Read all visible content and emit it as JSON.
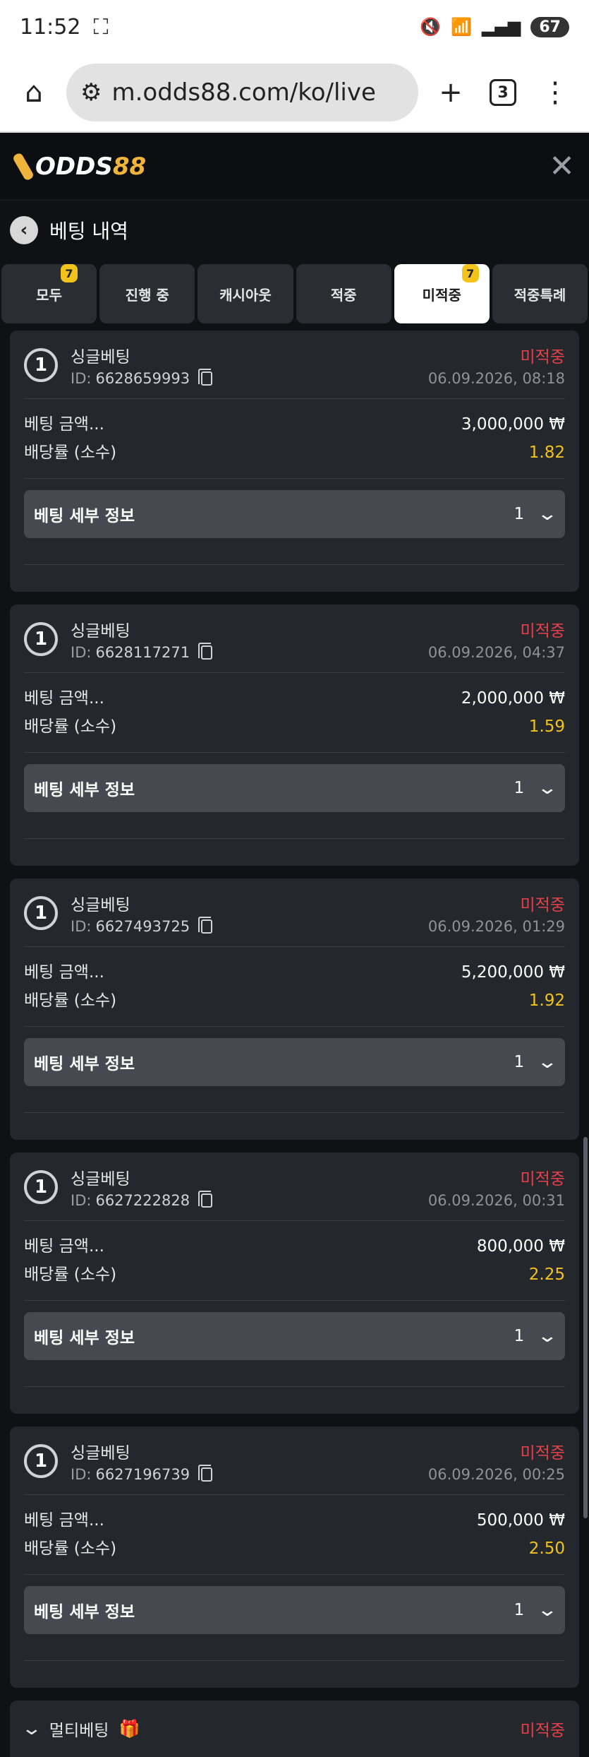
{
  "status_bar": {
    "time": "11:52",
    "battery": "67"
  },
  "browser": {
    "url": "m.odds88.com/ko/live",
    "tab_count": "3"
  },
  "app": {
    "logo_a": "ODDS",
    "logo_b": "88"
  },
  "page": {
    "title": "베팅 내역"
  },
  "tabs": [
    {
      "label": "모두",
      "badge": "7",
      "active": false
    },
    {
      "label": "진행 중",
      "badge": "",
      "active": false
    },
    {
      "label": "캐시아웃",
      "badge": "",
      "active": false
    },
    {
      "label": "적중",
      "badge": "",
      "active": false
    },
    {
      "label": "미적중",
      "badge": "7",
      "active": true
    },
    {
      "label": "적중특례",
      "badge": "",
      "active": false
    }
  ],
  "labels": {
    "amount": "베팅 금액...",
    "odds": "배당률 (소수)",
    "details": "베팅 세부 정보"
  },
  "bets": [
    {
      "num": "1",
      "type": "싱글베팅",
      "id": "6628659993",
      "status": "미적중",
      "date": "06.09.2026, 08:18",
      "amount": "3,000,000 ₩",
      "odds": "1.82",
      "count": "1"
    },
    {
      "num": "1",
      "type": "싱글베팅",
      "id": "6628117271",
      "status": "미적중",
      "date": "06.09.2026, 04:37",
      "amount": "2,000,000 ₩",
      "odds": "1.59",
      "count": "1"
    },
    {
      "num": "1",
      "type": "싱글베팅",
      "id": "6627493725",
      "status": "미적중",
      "date": "06.09.2026, 01:29",
      "amount": "5,200,000 ₩",
      "odds": "1.92",
      "count": "1"
    },
    {
      "num": "1",
      "type": "싱글베팅",
      "id": "6627222828",
      "status": "미적중",
      "date": "06.09.2026, 00:31",
      "amount": "800,000 ₩",
      "odds": "2.25",
      "count": "1"
    },
    {
      "num": "1",
      "type": "싱글베팅",
      "id": "6627196739",
      "status": "미적중",
      "date": "06.09.2026, 00:25",
      "amount": "500,000 ₩",
      "odds": "2.50",
      "count": "1"
    }
  ],
  "multi": {
    "type": "멀티베팅",
    "status": "미적중"
  }
}
